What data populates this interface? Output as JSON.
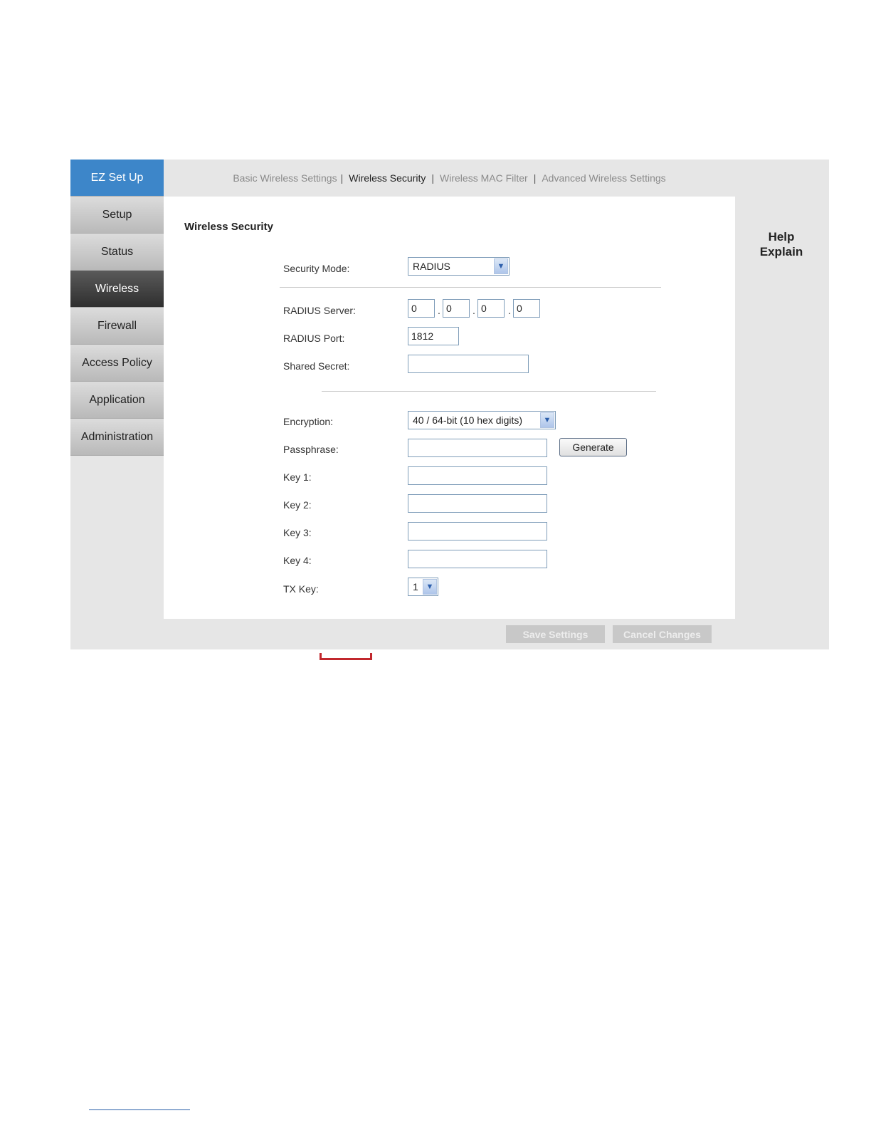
{
  "sidebar": {
    "items": [
      {
        "label": "EZ Set Up"
      },
      {
        "label": "Setup"
      },
      {
        "label": "Status"
      },
      {
        "label": "Wireless"
      },
      {
        "label": "Firewall"
      },
      {
        "label": "Access Policy"
      },
      {
        "label": "Application"
      },
      {
        "label": "Administration"
      }
    ],
    "active": "Wireless"
  },
  "tabs": {
    "basic": "Basic Wireless Settings",
    "security": "Wireless Security",
    "mac_filter": "Wireless MAC Filter",
    "advanced": "Advanced Wireless Settings",
    "separator": "|",
    "current": "Wireless Security"
  },
  "section_title": "Wireless Security",
  "help": {
    "line1": "Help",
    "line2": "Explain"
  },
  "form": {
    "security_mode": {
      "label": "Security Mode:",
      "value": "RADIUS"
    },
    "radius_server": {
      "label": "RADIUS Server:",
      "octets": [
        "0",
        "0",
        "0",
        "0"
      ],
      "dot": "."
    },
    "radius_port": {
      "label": "RADIUS Port:",
      "value": "1812"
    },
    "shared_secret": {
      "label": "Shared Secret:",
      "value": ""
    },
    "encryption": {
      "label": "Encryption:",
      "value": "40 / 64-bit (10 hex digits)"
    },
    "passphrase": {
      "label": "Passphrase:",
      "value": ""
    },
    "generate_button": "Generate",
    "key1": {
      "label": "Key 1:",
      "value": ""
    },
    "key2": {
      "label": "Key 2:",
      "value": ""
    },
    "key3": {
      "label": "Key 3:",
      "value": ""
    },
    "key4": {
      "label": "Key 4:",
      "value": ""
    },
    "tx_key": {
      "label": "TX Key:",
      "value": "1"
    }
  },
  "buttons": {
    "save": "Save Settings",
    "cancel": "Cancel Changes"
  },
  "icons": {
    "dropdown": "chevron-down-icon"
  },
  "colors": {
    "ez_setup": "#3d86c9",
    "active_nav": "#3a3a3a",
    "frame_bg": "#e6e6e6",
    "highlight_bracket": "#c1272d"
  }
}
